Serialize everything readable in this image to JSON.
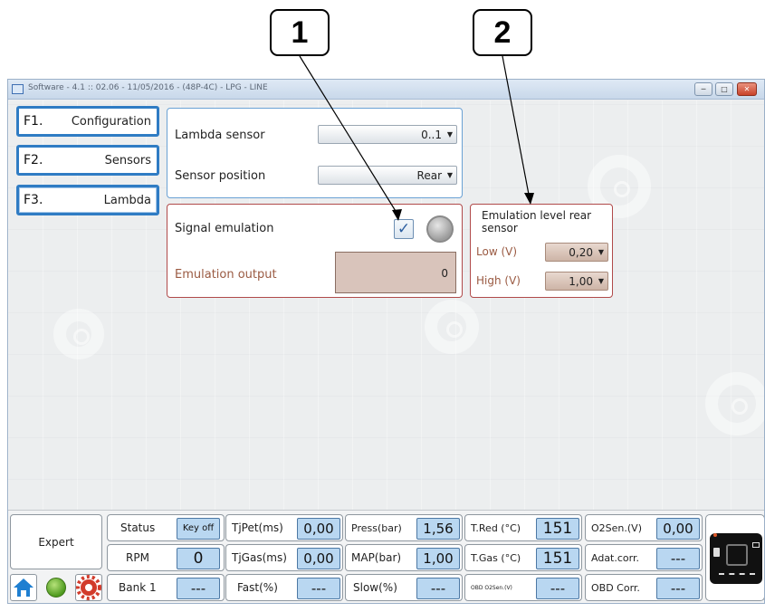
{
  "callouts": [
    "1",
    "2"
  ],
  "window": {
    "title": "Software - 4.1 :: 02.06 - 11/05/2016 - (48P-4C) - LPG - LINE",
    "controls": [
      "minimize",
      "maximize",
      "close"
    ]
  },
  "menu": [
    {
      "key": "F1.",
      "label": "Configuration"
    },
    {
      "key": "F2.",
      "label": "Sensors"
    },
    {
      "key": "F3.",
      "label": "Lambda"
    }
  ],
  "lambda_panel": {
    "sensor_label": "Lambda sensor",
    "sensor_value": "0..1",
    "position_label": "Sensor position",
    "position_value": "Rear"
  },
  "emulation_panel": {
    "signal_label": "Signal emulation",
    "signal_checked": true,
    "output_label": "Emulation output",
    "output_value": "0"
  },
  "level_panel": {
    "title": "Emulation level rear sensor",
    "low_label": "Low (V)",
    "low_value": "0,20",
    "high_label": "High (V)",
    "high_value": "1,00"
  },
  "statusbar": {
    "mode": "Expert",
    "col1": [
      {
        "label": "Status",
        "value": "Key off"
      },
      {
        "label": "RPM",
        "value": "0"
      },
      {
        "label": "Bank 1",
        "value": "---"
      }
    ],
    "col2": [
      {
        "label": "TjPet(ms)",
        "value": "0,00"
      },
      {
        "label": "TjGas(ms)",
        "value": "0,00"
      },
      {
        "label": "Fast(%)",
        "value": "---"
      }
    ],
    "col3": [
      {
        "label": "Press(bar)",
        "value": "1,56"
      },
      {
        "label": "MAP(bar)",
        "value": "1,00"
      },
      {
        "label": "Slow(%)",
        "value": "---"
      }
    ],
    "col4": [
      {
        "label": "T.Red (°C)",
        "value": "151"
      },
      {
        "label": "T.Gas (°C)",
        "value": "151"
      },
      {
        "label": "OBD O2Sen.(V)",
        "value": "---"
      }
    ],
    "col5": [
      {
        "label": "O2Sen.(V)",
        "value": "0,00"
      },
      {
        "label": "Adat.corr.",
        "value": "---"
      },
      {
        "label": "OBD Corr.",
        "value": "---"
      }
    ]
  },
  "colors": {
    "panel_blue": "#6aa1d4",
    "panel_red": "#b04a4a",
    "value_bg": "#b9d7f1",
    "brown_text": "#9a5a42"
  }
}
